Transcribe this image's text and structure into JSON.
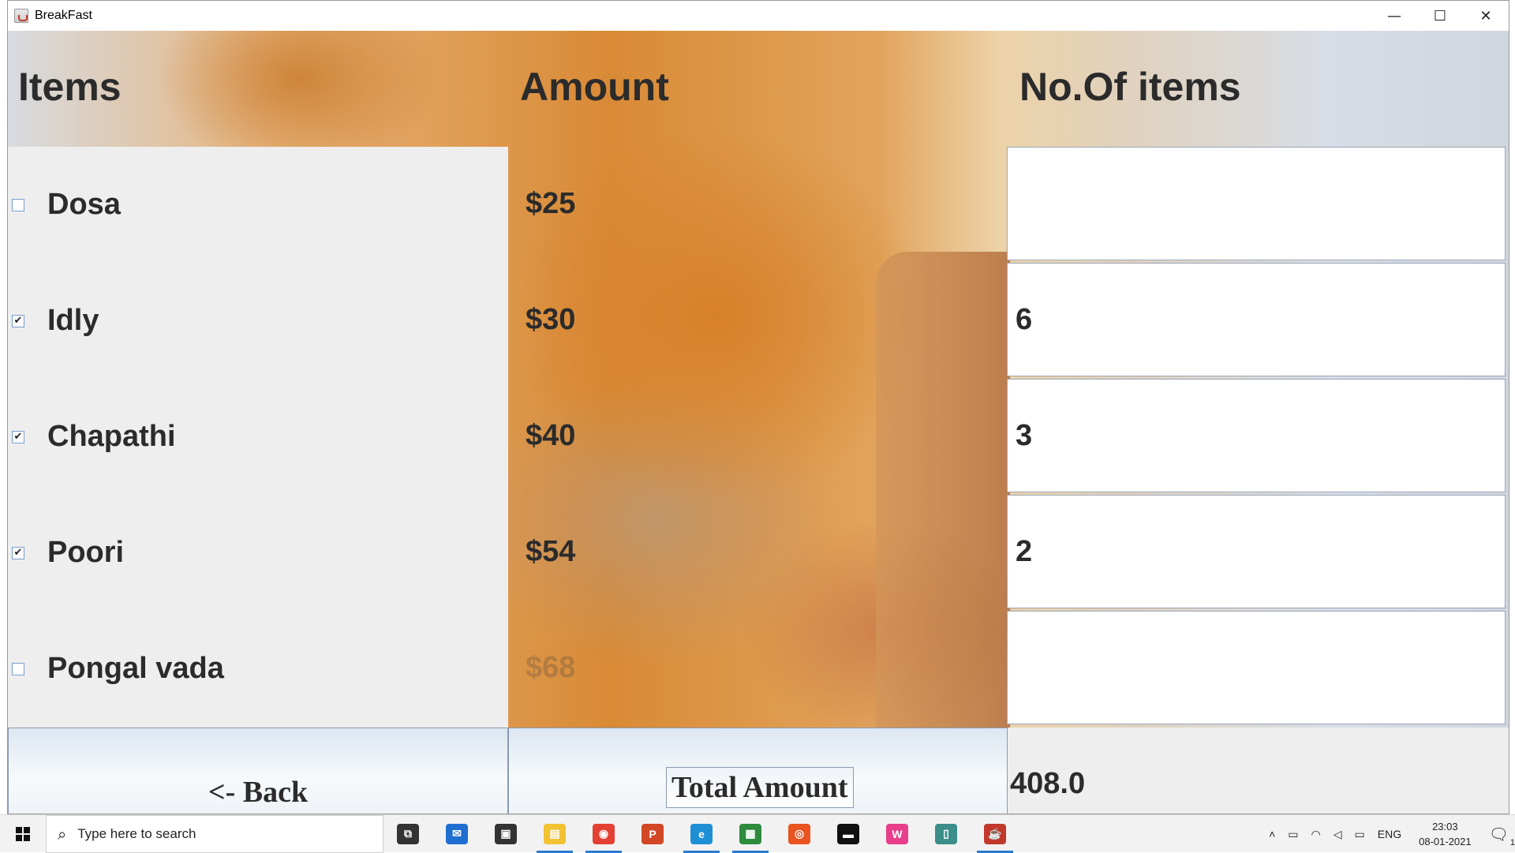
{
  "window": {
    "title": "BreakFast",
    "controls": {
      "minimize": "—",
      "maximize": "☐",
      "close": "✕"
    }
  },
  "headers": {
    "items": "Items",
    "amount": "Amount",
    "count": "No.Of items"
  },
  "rows": [
    {
      "item": "Dosa",
      "checked": false,
      "check": "",
      "price": "$25",
      "qty": ""
    },
    {
      "item": "Idly",
      "checked": true,
      "check": "✔",
      "price": "$30",
      "qty": "6"
    },
    {
      "item": "Chapathi",
      "checked": true,
      "check": "✔",
      "price": "$40",
      "qty": "3"
    },
    {
      "item": "Poori",
      "checked": true,
      "check": "✔",
      "price": "$54",
      "qty": "2"
    },
    {
      "item": "Pongal vada",
      "checked": false,
      "check": "",
      "price": "$68",
      "qty": ""
    }
  ],
  "buttons": {
    "back": "<- Back",
    "total": "Total Amount"
  },
  "total_value": "408.0",
  "taskbar": {
    "search_placeholder": "Type here to search",
    "apps": [
      {
        "icon": "task-view-icon",
        "color": "#333333",
        "label": "⧉"
      },
      {
        "icon": "mail-icon",
        "color": "#1f6fd1",
        "label": "✉"
      },
      {
        "icon": "store-icon",
        "color": "#333333",
        "label": "▣"
      },
      {
        "icon": "file-explorer-icon",
        "color": "#f2c233",
        "label": "▤"
      },
      {
        "icon": "chrome-icon",
        "color": "#e34133",
        "label": "◉"
      },
      {
        "icon": "powerpoint-icon",
        "color": "#d24726",
        "label": "P"
      },
      {
        "icon": "edge-icon",
        "color": "#1e8fd5",
        "label": "e"
      },
      {
        "icon": "app-green-icon",
        "color": "#2e8b3e",
        "label": "▦"
      },
      {
        "icon": "ubuntu-icon",
        "color": "#e95420",
        "label": "◎"
      },
      {
        "icon": "terminal-icon",
        "color": "#111111",
        "label": "▬"
      },
      {
        "icon": "app-pink-icon",
        "color": "#e83e8c",
        "label": "W"
      },
      {
        "icon": "app-window-icon",
        "color": "#3c8e8a",
        "label": "▯"
      },
      {
        "icon": "java-icon",
        "color": "#c0392b",
        "label": "☕"
      }
    ],
    "tray": {
      "language": "ENG",
      "time": "23:03",
      "date": "08-01-2021",
      "notifications": "1"
    }
  }
}
